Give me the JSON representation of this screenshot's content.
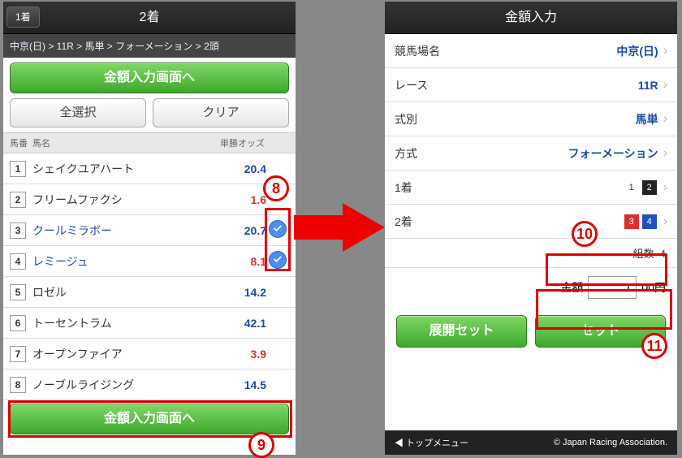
{
  "left": {
    "back_tab": "1着",
    "title": "2着",
    "breadcrumb": "中京(日) > 11R > 馬単 > フォーメーション > 2頭",
    "go_amount": "金額入力画面へ",
    "select_all": "全選択",
    "clear": "クリア",
    "head_num": "馬番",
    "head_name": "馬名",
    "head_odds": "単勝オッズ",
    "horses": [
      {
        "n": "1",
        "cls": "n-white",
        "name": "シェイクユアハート",
        "odds": "20.4",
        "oc": "#1a4ba8",
        "sel": false
      },
      {
        "n": "2",
        "cls": "n-black",
        "name": "フリームファクシ",
        "odds": "1.6",
        "oc": "#d83030",
        "sel": false
      },
      {
        "n": "3",
        "cls": "n-red",
        "name": "クールミラボー",
        "odds": "20.7",
        "oc": "#1a4ba8",
        "sel": true
      },
      {
        "n": "4",
        "cls": "n-blue",
        "name": "レミージュ",
        "odds": "8.1",
        "oc": "#d83030",
        "sel": true
      },
      {
        "n": "5",
        "cls": "n-yellow",
        "name": "ロゼル",
        "odds": "14.2",
        "oc": "#1a4ba8",
        "sel": false
      },
      {
        "n": "6",
        "cls": "n-green",
        "name": "トーセントラム",
        "odds": "42.1",
        "oc": "#1a4ba8",
        "sel": false
      },
      {
        "n": "7",
        "cls": "n-orange",
        "name": "オープンファイア",
        "odds": "3.9",
        "oc": "#d83030",
        "sel": false
      },
      {
        "n": "8",
        "cls": "n-white",
        "name": "ノーブルライジング",
        "odds": "14.5",
        "oc": "#1a4ba8",
        "sel": false
      }
    ],
    "go_amount2": "金額入力画面へ"
  },
  "right": {
    "title": "金額入力",
    "rows": {
      "venue_l": "競馬場名",
      "venue_v": "中京(日)",
      "race_l": "レース",
      "race_v": "11R",
      "type_l": "式別",
      "type_v": "馬単",
      "method_l": "方式",
      "method_v": "フォーメーション",
      "p1_l": "1着",
      "p1_chips": [
        {
          "n": "1",
          "cls": "n-white"
        },
        {
          "n": "2",
          "cls": "n-black"
        }
      ],
      "p2_l": "2着",
      "p2_chips": [
        {
          "n": "3",
          "cls": "n-red"
        },
        {
          "n": "4",
          "cls": "n-blue"
        }
      ]
    },
    "combo_l": "組数",
    "combo_v": "4",
    "amt_l": "金額",
    "amt_v": "1",
    "amt_suffix": "00円",
    "expand": "展開セット",
    "set": "セット",
    "foot_l": "◀ トップメニュー",
    "foot_r": "© Japan Racing Association."
  },
  "anno": {
    "a8": "8",
    "a9": "9",
    "a10": "10",
    "a11": "11"
  }
}
